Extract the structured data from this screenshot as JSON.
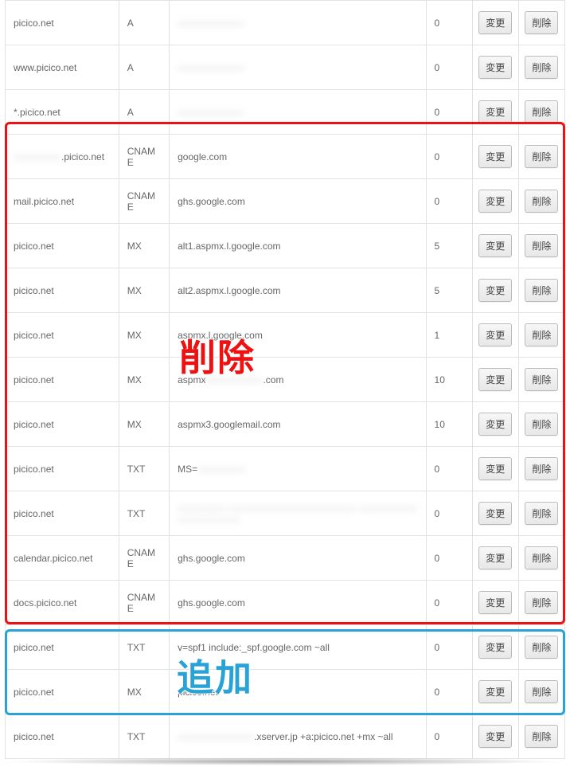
{
  "buttons": {
    "edit": "変更",
    "delete": "削除"
  },
  "overlay": {
    "delete_label": "削除",
    "add_label": "追加"
  },
  "rows": [
    {
      "host": "picico.net",
      "type": "A",
      "value": "",
      "value_blur": true,
      "priority": "0"
    },
    {
      "host": "www.picico.net",
      "type": "A",
      "value": "",
      "value_blur": true,
      "priority": "0"
    },
    {
      "host": "*.picico.net",
      "type": "A",
      "value": "",
      "value_blur": true,
      "priority": "0"
    },
    {
      "host_blur_prefix": true,
      "host_suffix": ".picico.net",
      "type": "CNAME",
      "value": "google.com",
      "priority": "0"
    },
    {
      "host": "mail.picico.net",
      "type": "CNAME",
      "value": "ghs.google.com",
      "priority": "0"
    },
    {
      "host": "picico.net",
      "type": "MX",
      "value": "alt1.aspmx.l.google.com",
      "priority": "5"
    },
    {
      "host": "picico.net",
      "type": "MX",
      "value": "alt2.aspmx.l.google.com",
      "priority": "5"
    },
    {
      "host": "picico.net",
      "type": "MX",
      "value": "aspmx.l.google.com",
      "priority": "1"
    },
    {
      "host": "picico.net",
      "type": "MX",
      "value_prefix": "aspmx",
      "value_blur_mid": true,
      "value_suffix": ".com",
      "priority": "10"
    },
    {
      "host": "picico.net",
      "type": "MX",
      "value": "aspmx3.googlemail.com",
      "priority": "10"
    },
    {
      "host": "picico.net",
      "type": "TXT",
      "value_prefix": "MS=",
      "value_blur_suffix": true,
      "priority": "0"
    },
    {
      "host": "picico.net",
      "type": "TXT",
      "value": "",
      "value_blur": true,
      "tall": true,
      "priority": "0"
    },
    {
      "host": "calendar.picico.net",
      "type": "CNAME",
      "value": "ghs.google.com",
      "priority": "0"
    },
    {
      "host": "docs.picico.net",
      "type": "CNAME",
      "value": "ghs.google.com",
      "priority": "0"
    },
    {
      "host": "picico.net",
      "type": "TXT",
      "value": "v=spf1 include:_spf.google.com ~all",
      "priority": "0"
    },
    {
      "host": "picico.net",
      "type": "MX",
      "value": "picico.net",
      "priority": "0"
    },
    {
      "host": "picico.net",
      "type": "TXT",
      "value_blur_prefix": true,
      "value_suffix": ".xserver.jp +a:picico.net +mx ~all",
      "priority": "0"
    }
  ]
}
